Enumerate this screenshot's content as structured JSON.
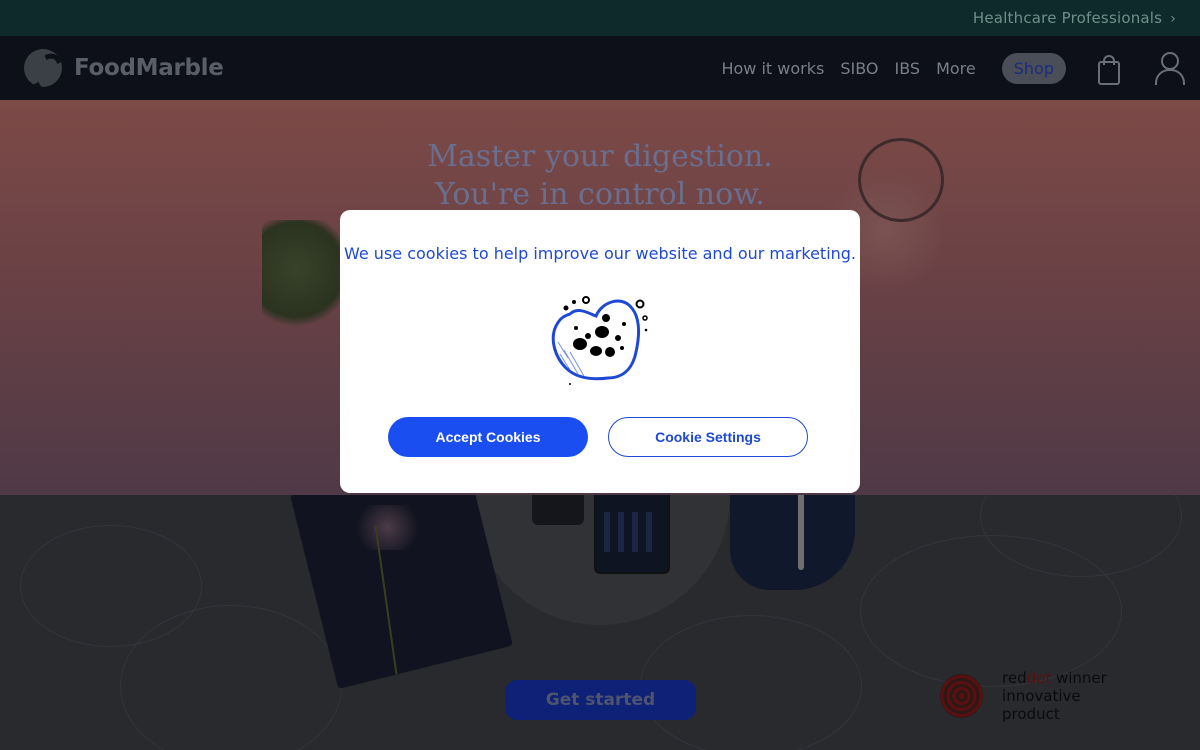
{
  "topbar": {
    "professionals_link": "Healthcare Professionals"
  },
  "brand": {
    "name": "FoodMarble"
  },
  "nav": {
    "links": [
      "How it works",
      "SIBO",
      "IBS",
      "More"
    ],
    "shop_label": "Shop",
    "icons": [
      "shopping-bag-icon",
      "user-account-icon"
    ]
  },
  "hero": {
    "title_line1": "Master your digestion.",
    "title_line2": "You're in control now.",
    "cta_label": "Get started"
  },
  "award": {
    "brand_red": "red",
    "brand_dot": "dot",
    "winner": " winner",
    "subtitle": "innovative product"
  },
  "cookie_modal": {
    "message": "We use cookies to help improve our website and our marketing.",
    "accept_label": "Accept Cookies",
    "settings_label": "Cookie Settings",
    "illustration": "cookie-illustration"
  },
  "colors": {
    "accent_blue": "#1b4ef0",
    "text_blue": "#1e49d6",
    "topbar_bg": "#0f2a2b",
    "navbar_bg": "#0d1018"
  }
}
